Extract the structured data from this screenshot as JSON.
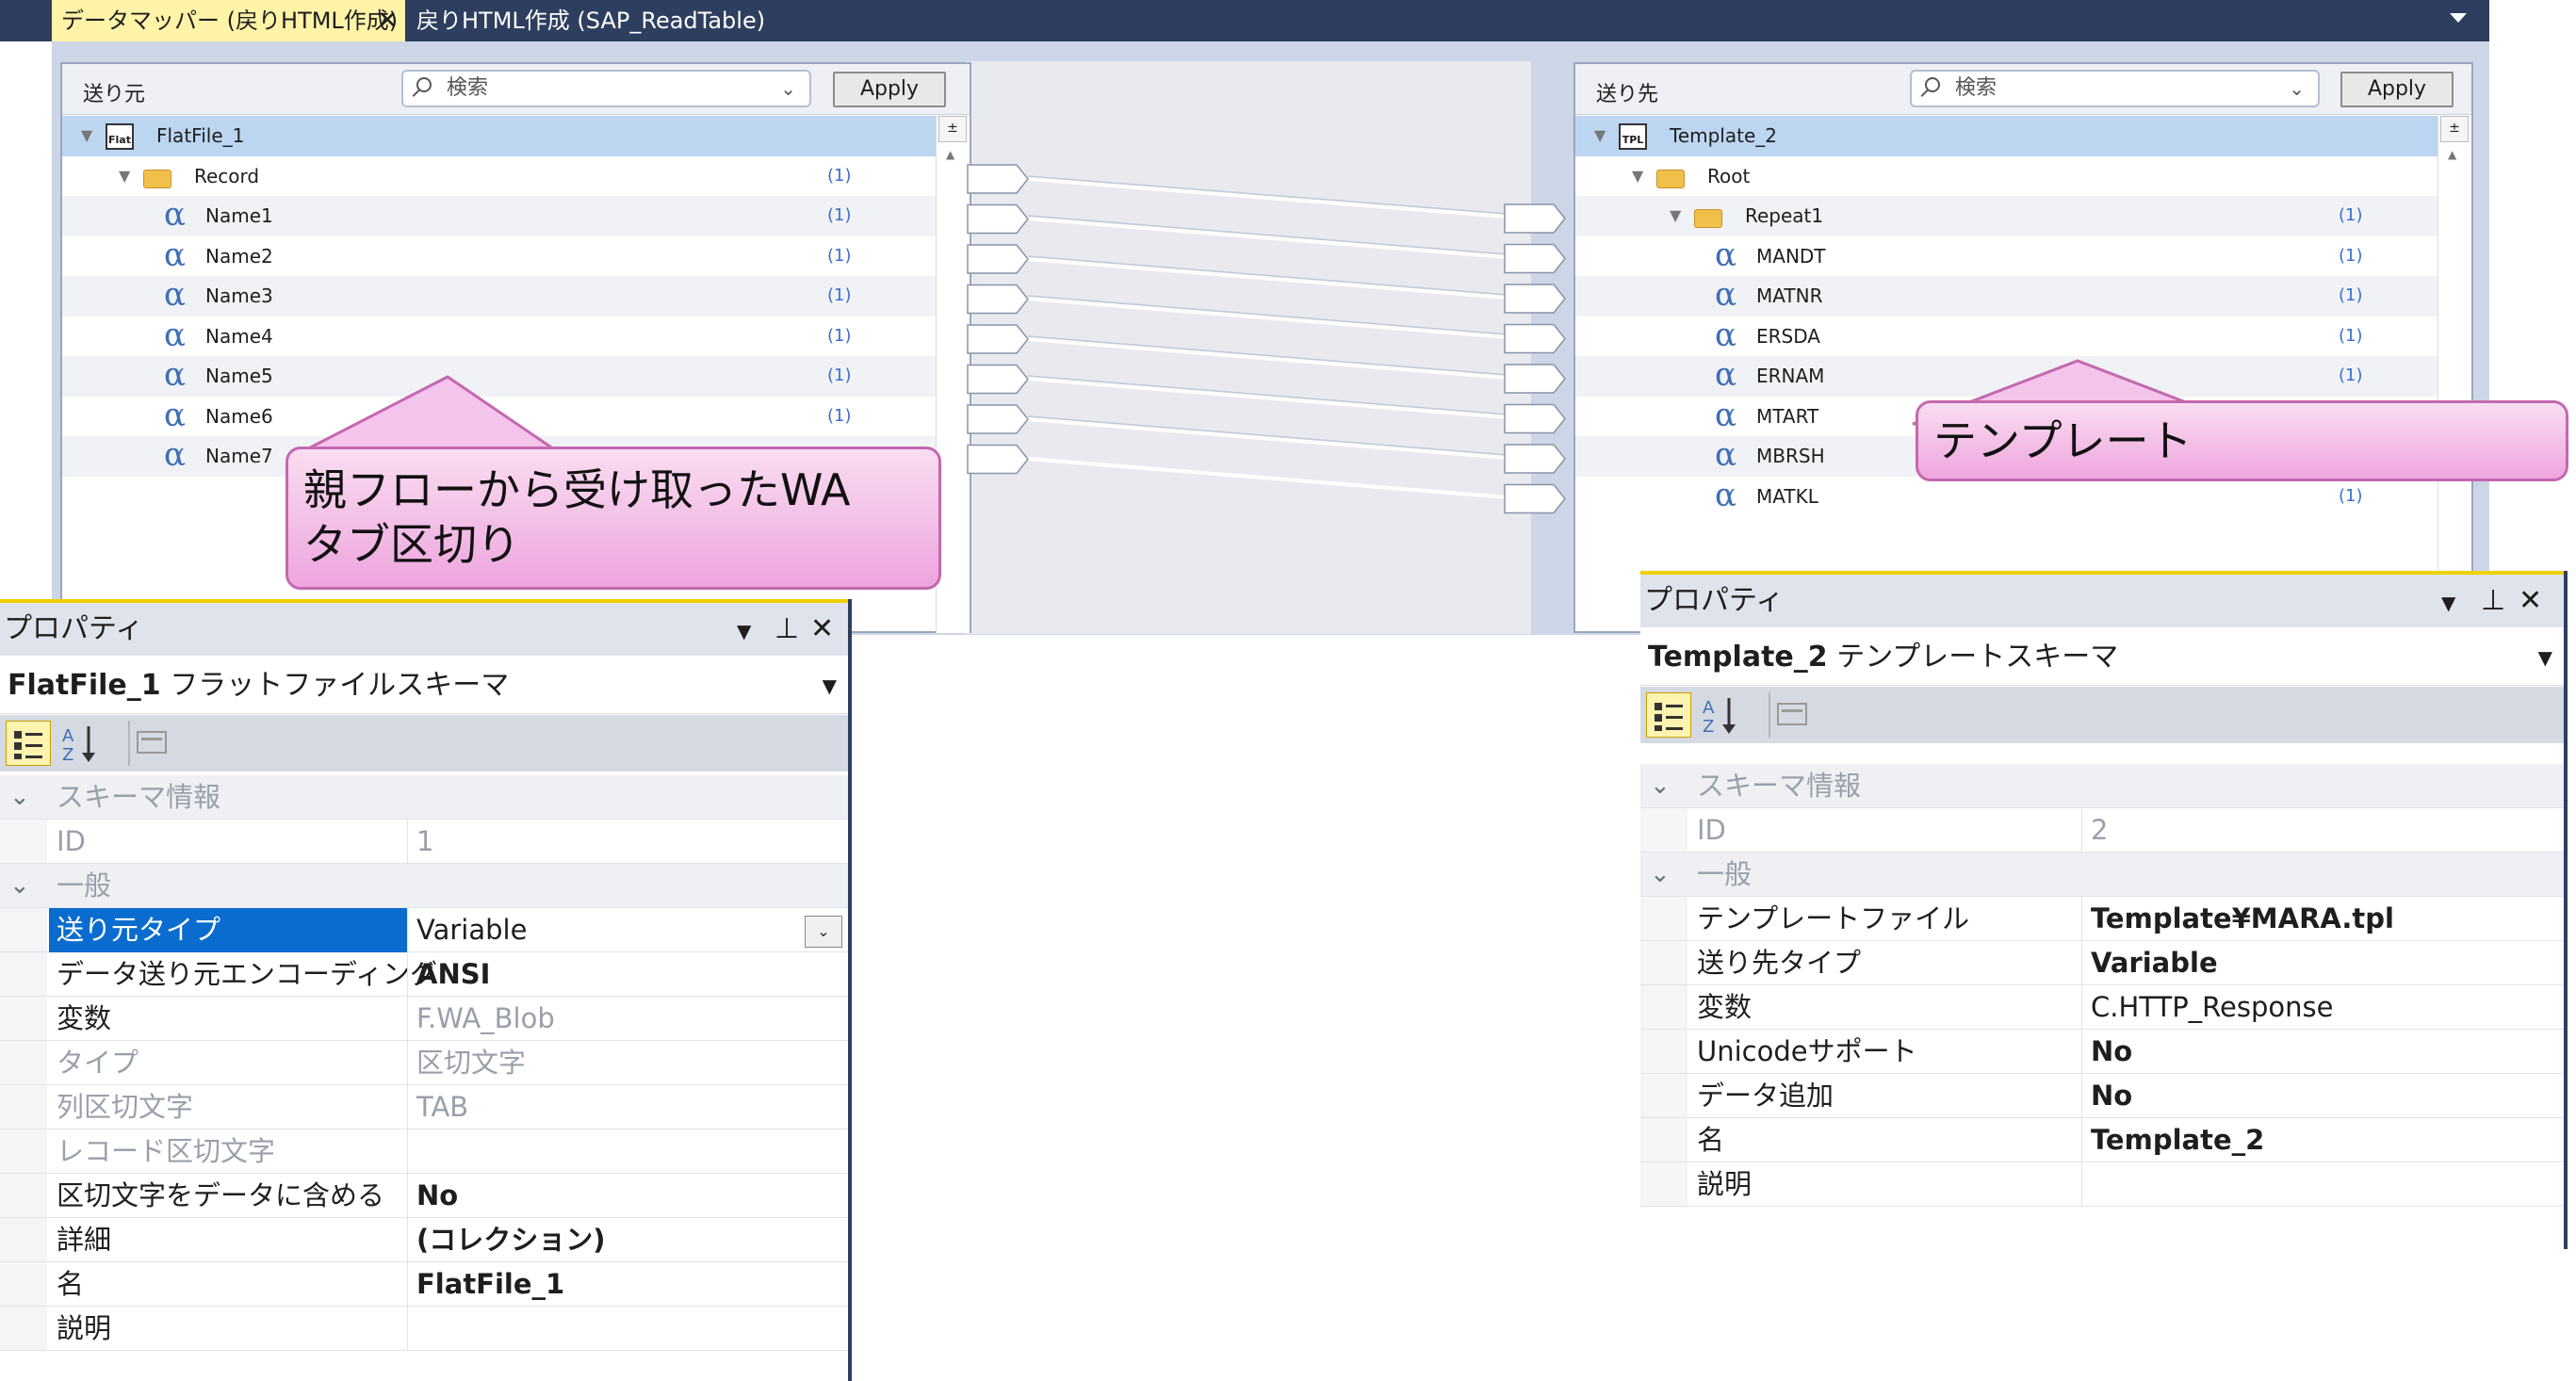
{
  "tabs": [
    {
      "label": "データマッパー (戻りHTML作成)",
      "close": "✕"
    },
    {
      "label": "戻りHTML作成 (SAP_ReadTable)"
    }
  ],
  "source_panel": {
    "header": "送り元",
    "search_placeholder": "検索",
    "apply": "Apply",
    "tree": [
      {
        "name": "FlatFile_1",
        "icon": "Flat",
        "card": ""
      },
      {
        "name": "Record",
        "card": "(1)"
      },
      {
        "name": "Name1",
        "card": "(1)"
      },
      {
        "name": "Name2",
        "card": "(1)"
      },
      {
        "name": "Name3",
        "card": "(1)"
      },
      {
        "name": "Name4",
        "card": "(1)"
      },
      {
        "name": "Name5",
        "card": "(1)"
      },
      {
        "name": "Name6",
        "card": "(1)"
      },
      {
        "name": "Name7",
        "card": ""
      }
    ]
  },
  "dest_panel": {
    "header": "送り先",
    "search_placeholder": "検索",
    "apply": "Apply",
    "tree": [
      {
        "name": "Template_2",
        "icon": "TPL",
        "card": ""
      },
      {
        "name": "Root",
        "card": ""
      },
      {
        "name": "Repeat1",
        "card": "(1)"
      },
      {
        "name": "MANDT",
        "card": "(1)"
      },
      {
        "name": "MATNR",
        "card": "(1)"
      },
      {
        "name": "ERSDA",
        "card": "(1)"
      },
      {
        "name": "ERNAM",
        "card": "(1)"
      },
      {
        "name": "MTART",
        "card": ""
      },
      {
        "name": "MBRSH",
        "card": ""
      },
      {
        "name": "MATKL",
        "card": "(1)"
      }
    ]
  },
  "callouts": {
    "source": "親フローから受け取ったWA\nタブ区切り",
    "dest": "テンプレート"
  },
  "left_props": {
    "title": "プロパティ",
    "object_name": "FlatFile_1",
    "object_type": "フラットファイルスキーマ",
    "rows": [
      {
        "cat": "スキーマ情報"
      },
      {
        "k": "ID",
        "v": "1",
        "muted": true
      },
      {
        "cat": "一般"
      },
      {
        "k": "送り元タイプ",
        "v": "Variable",
        "selected": true
      },
      {
        "k": "データ送り元エンコーディング",
        "v": "ANSI",
        "bold": true
      },
      {
        "k": "変数",
        "v": "F.WA_Blob",
        "muted_v": true
      },
      {
        "k": "タイプ",
        "v": "区切文字",
        "muted": true
      },
      {
        "k": "列区切文字",
        "v": "TAB",
        "muted": true
      },
      {
        "k": "レコード区切文字",
        "v": "",
        "muted": true
      },
      {
        "k": "区切文字をデータに含める",
        "v": "No",
        "bold": true
      },
      {
        "k": "詳細",
        "v": "(コレクション)",
        "bold": true
      },
      {
        "k": "名",
        "v": "FlatFile_1",
        "bold": true
      },
      {
        "k": "説明",
        "v": ""
      }
    ]
  },
  "right_props": {
    "title": "プロパティ",
    "object_name": "Template_2",
    "object_type": "テンプレートスキーマ",
    "rows": [
      {
        "cat": "スキーマ情報"
      },
      {
        "k": "ID",
        "v": "2",
        "muted": true
      },
      {
        "cat": "一般"
      },
      {
        "k": "テンプレートファイル",
        "v": "Template¥MARA.tpl",
        "bold": true
      },
      {
        "k": "送り先タイプ",
        "v": "Variable",
        "bold": true
      },
      {
        "k": "変数",
        "v": "C.HTTP_Response"
      },
      {
        "k": "Unicodeサポート",
        "v": "No",
        "bold": true
      },
      {
        "k": "データ追加",
        "v": "No",
        "bold": true
      },
      {
        "k": "名",
        "v": "Template_2",
        "bold": true
      },
      {
        "k": "説明",
        "v": ""
      }
    ]
  },
  "colors": {
    "titlebar": "#2d3e5f",
    "active_tab": "#fff3a8",
    "selection": "#0a6ccf",
    "tree_selected": "#bcd5f0",
    "callout": "#eea5de"
  }
}
